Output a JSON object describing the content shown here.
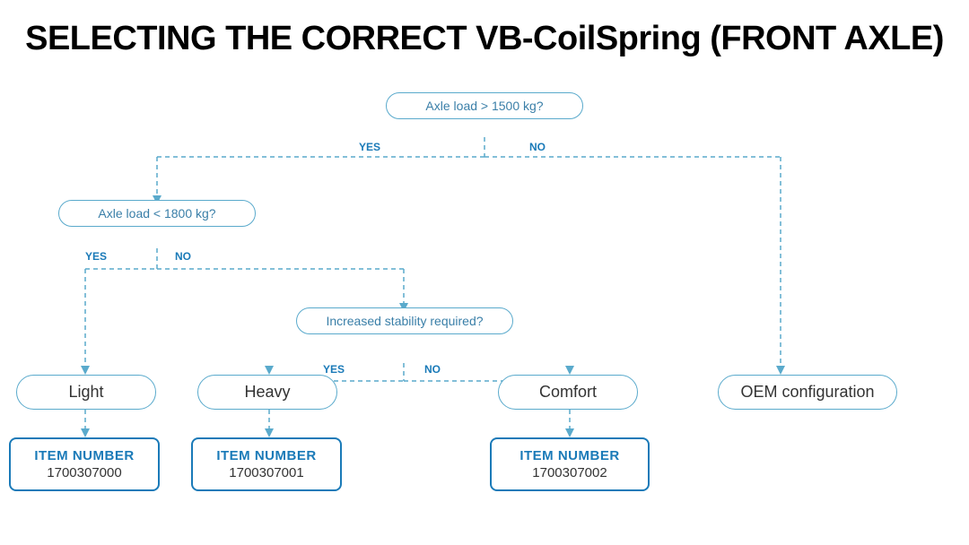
{
  "title": "SELECTING THE CORRECT VB-CoilSpring (FRONT AXLE)",
  "nodes": {
    "q1": {
      "text": "Axle load > 1500 kg?",
      "yes": "YES",
      "no": "NO"
    },
    "q2": {
      "text": "Axle load < 1800 kg?",
      "yes": "YES",
      "no": "NO"
    },
    "q3": {
      "text": "Increased stability required?",
      "yes": "YES",
      "no": "NO"
    },
    "r1": {
      "text": "Light"
    },
    "r2": {
      "text": "Heavy"
    },
    "r3": {
      "text": "Comfort"
    },
    "r4": {
      "text": "OEM configuration"
    },
    "i1": {
      "label": "ITEM NUMBER",
      "number": "1700307000"
    },
    "i2": {
      "label": "ITEM NUMBER",
      "number": "1700307001"
    },
    "i3": {
      "label": "ITEM NUMBER",
      "number": "1700307002"
    }
  }
}
